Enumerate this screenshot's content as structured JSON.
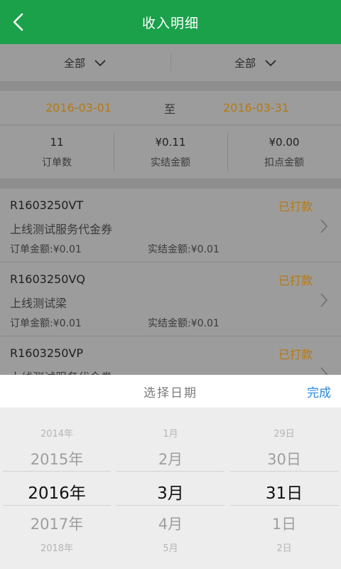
{
  "header": {
    "title": "收入明细"
  },
  "filters": [
    {
      "label": "全部"
    },
    {
      "label": "全部"
    }
  ],
  "date_range": {
    "start": "2016-03-01",
    "separator": "至",
    "end": "2016-03-31"
  },
  "stats": [
    {
      "value": "11",
      "label": "订单数"
    },
    {
      "value": "¥0.11",
      "label": "实结金额"
    },
    {
      "value": "¥0.00",
      "label": "扣点金额"
    }
  ],
  "orders": [
    {
      "id": "R1603250VT",
      "status": "已打款",
      "name": "上线测试服务代金券",
      "order_amount": "订单金额:¥0.01",
      "settled_amount": "实结金额:¥0.01"
    },
    {
      "id": "R1603250VQ",
      "status": "已打款",
      "name": "上线测试梁",
      "order_amount": "订单金额:¥0.01",
      "settled_amount": "实结金额:¥0.01"
    },
    {
      "id": "R1603250VP",
      "status": "已打款",
      "name": "上线测试服务代金券",
      "order_amount": "",
      "settled_amount": ""
    }
  ],
  "picker": {
    "title": "选择日期",
    "done_label": "完成",
    "years": [
      "2014年",
      "2015年",
      "2016年",
      "2017年",
      "2018年"
    ],
    "months": [
      "1月",
      "2月",
      "3月",
      "4月",
      "5月"
    ],
    "days": [
      "29日",
      "30日",
      "31日",
      "1日",
      "2日"
    ],
    "selected": {
      "year": "2016年",
      "month": "3月",
      "day": "31日"
    }
  },
  "colors": {
    "header_green": "#1aa14a",
    "accent_orange": "#b57a12",
    "done_blue": "#2a88e0"
  }
}
